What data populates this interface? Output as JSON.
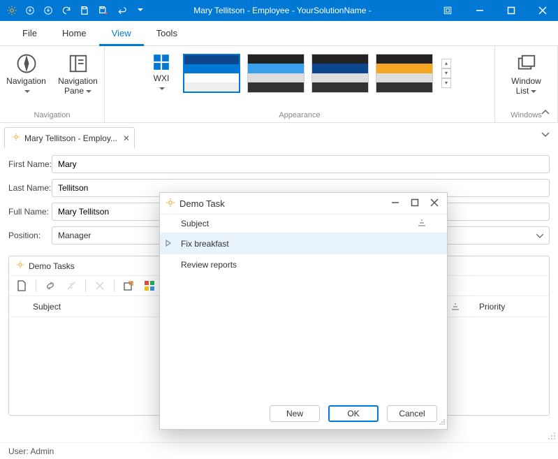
{
  "title": "Mary Tellitson - Employee - YourSolutionName -",
  "menu": {
    "file": "File",
    "home": "Home",
    "view": "View",
    "tools": "Tools"
  },
  "ribbon": {
    "nav_group": "Navigation",
    "appearance_group": "Appearance",
    "windows_group": "Windows",
    "navigation_btn": "Navigation",
    "navpane_btn": "Navigation Pane",
    "wxi_btn": "WXI",
    "windowlist_btn": "Window List"
  },
  "doctab": {
    "title": "Mary Tellitson - Employ..."
  },
  "form": {
    "firstname_lbl": "First Name:",
    "firstname": "Mary",
    "lastname_lbl": "Last Name:",
    "lastname": "Tellitson",
    "fullname_lbl": "Full Name:",
    "fullname": "Mary Tellitson",
    "position_lbl": "Position:",
    "position": "Manager"
  },
  "panel": {
    "title": "Demo Tasks",
    "col_subject": "Subject",
    "col_priority": "Priority"
  },
  "status": {
    "user": "User: Admin"
  },
  "dialog": {
    "title": "Demo Task",
    "col_subject": "Subject",
    "items": [
      "Fix breakfast",
      "Review reports"
    ],
    "new_btn": "New",
    "ok_btn": "OK",
    "cancel_btn": "Cancel"
  }
}
